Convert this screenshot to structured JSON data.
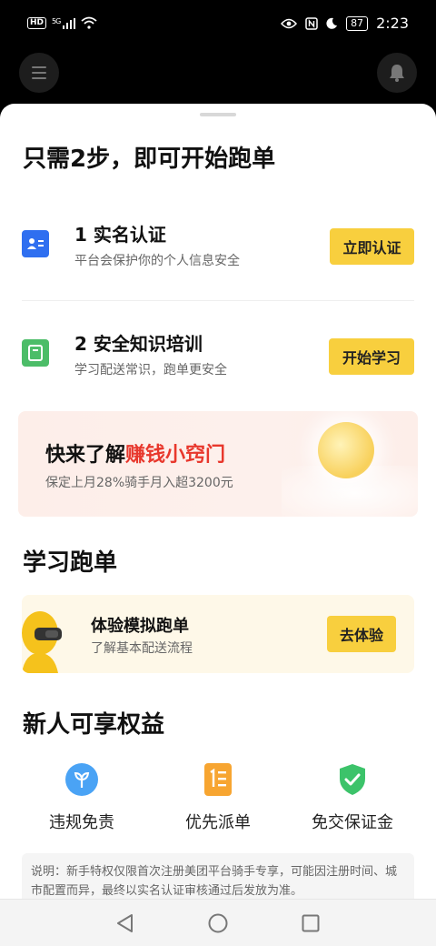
{
  "status_bar": {
    "hd": "HD",
    "signal": "5G",
    "battery": "87",
    "time": "2:23"
  },
  "header": {
    "title": "只需2步，即可开始跑单"
  },
  "steps": [
    {
      "title": "1 实名认证",
      "subtitle": "平台会保护你的个人信息安全",
      "button": "立即认证",
      "icon": "id-card-icon",
      "icon_color": "#2f6ff0"
    },
    {
      "title": "2 安全知识培训",
      "subtitle": "学习配送常识，跑单更安全",
      "button": "开始学习",
      "icon": "book-icon",
      "icon_color": "#4cbd68"
    }
  ],
  "promo": {
    "title_prefix": "快来了解",
    "title_highlight": "赚钱小窍门",
    "subtitle": "保定上月28%骑手月入超3200元",
    "highlight_color": "#e8382d"
  },
  "learn": {
    "heading": "学习跑单",
    "card_title": "体验模拟跑单",
    "card_subtitle": "了解基本配送流程",
    "button": "去体验"
  },
  "benefits": {
    "heading": "新人可享权益",
    "items": [
      {
        "label": "违规免责",
        "icon": "sprout-icon",
        "color": "#4aa3f5"
      },
      {
        "label": "优先派单",
        "icon": "priority-list-icon",
        "color": "#f7a531"
      },
      {
        "label": "免交保证金",
        "icon": "shield-check-icon",
        "color": "#3cc36a"
      }
    ]
  },
  "note": {
    "text": "说明：新手特权仅限首次注册美团平台骑手专享，可能因注册时间、城市配置而异，最终以实名认证审核通过后发放为准。"
  },
  "colors": {
    "accent_yellow": "#f8cf3e",
    "background_dark": "#000000"
  }
}
